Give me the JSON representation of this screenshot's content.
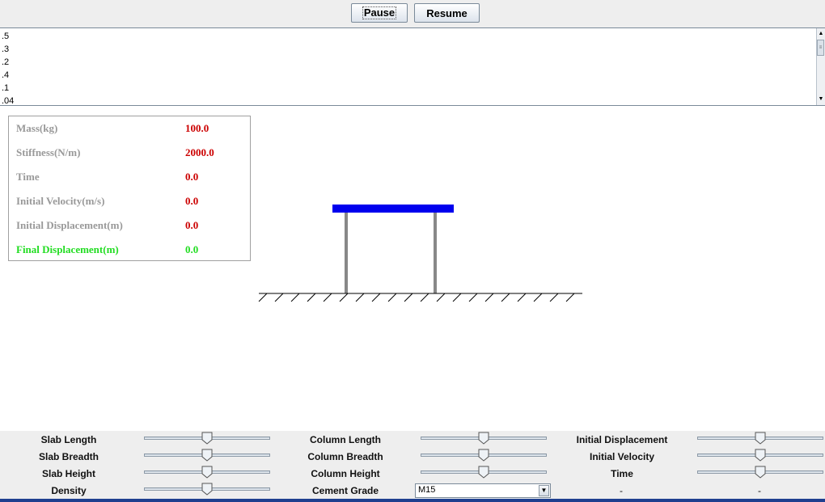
{
  "toolbar": {
    "pause_label": "Pause",
    "resume_label": "Resume"
  },
  "log": {
    "lines": [
      ".5",
      ".3",
      ".2",
      ".4",
      ".1",
      ".04"
    ]
  },
  "info": {
    "mass": {
      "label": "Mass(kg)",
      "value": "100.0"
    },
    "stiffness": {
      "label": "Stiffness(N/m)",
      "value": "2000.0"
    },
    "time": {
      "label": "Time",
      "value": "0.0"
    },
    "init_vel": {
      "label": "Initial Velocity(m/s)",
      "value": "0.0"
    },
    "init_disp": {
      "label": "Initial Displacement(m)",
      "value": "0.0"
    },
    "final_disp": {
      "label": "Final Displacement(m)",
      "value": "0.0"
    }
  },
  "controls": {
    "slab_length": {
      "label": "Slab Length",
      "level": 0.5
    },
    "slab_breadth": {
      "label": "Slab Breadth",
      "level": 0.5
    },
    "slab_height": {
      "label": "Slab Height",
      "level": 0.5
    },
    "density": {
      "label": "Density",
      "level": 0.5
    },
    "column_length": {
      "label": "Column Length",
      "level": 0.5
    },
    "column_breadth": {
      "label": "Column Breadth",
      "level": 0.5
    },
    "column_height": {
      "label": "Column Height",
      "level": 0.5
    },
    "cement_grade": {
      "label": "Cement Grade",
      "value": "M15"
    },
    "init_disp": {
      "label": "Initial Displacement",
      "level": 0.5
    },
    "init_vel": {
      "label": "Initial Velocity",
      "level": 0.5
    },
    "time": {
      "label": "Time",
      "level": 0.5
    },
    "dash1": "-",
    "dash2": "-"
  },
  "colors": {
    "slab": "#0000ee",
    "column": "#888888",
    "value_text": "#cc0000",
    "final_text": "#22dd22",
    "label_text": "#999999"
  }
}
